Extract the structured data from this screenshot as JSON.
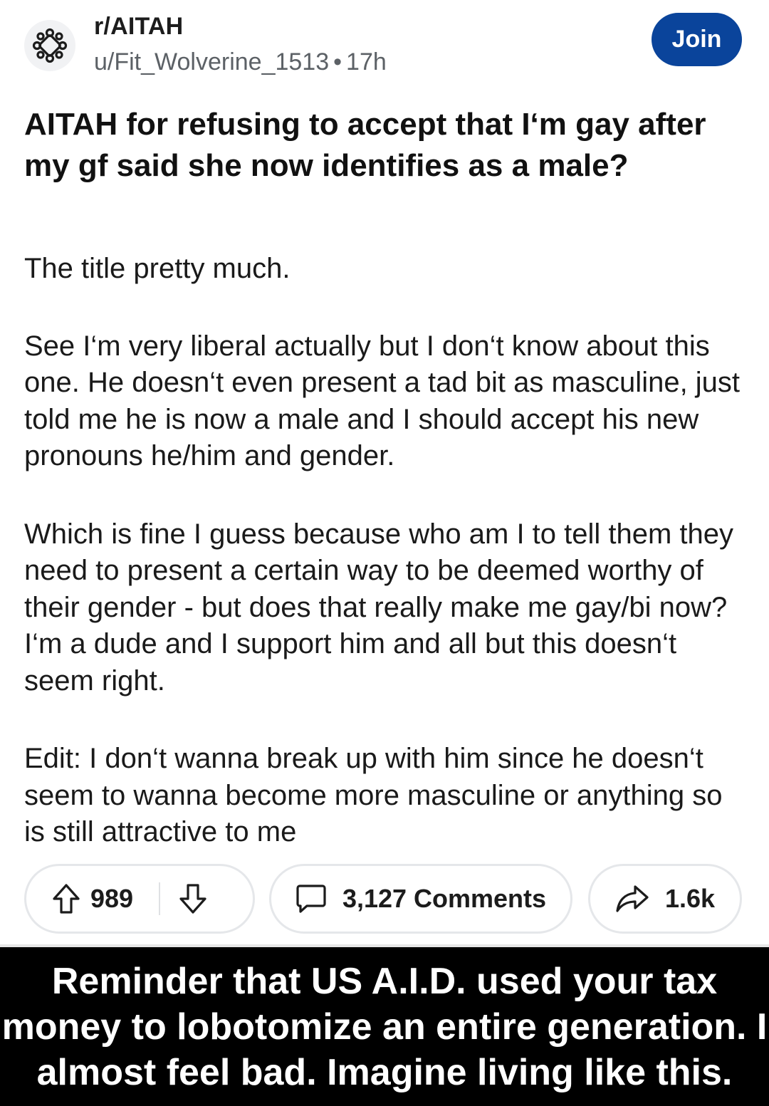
{
  "post": {
    "subreddit": "r/AITAH",
    "author": "u/Fit_Wolverine_1513",
    "separator": "•",
    "age": "17h",
    "join_label": "Join",
    "title": "AITAH for refusing to accept that I‘m gay after my gf said she now identifies as a male?",
    "body": [
      "The title pretty much.",
      "See I‘m very liberal actually but I don‘t know about this one. He doesn‘t even present a tad bit as masculine, just told me he is now a male and I should accept his new pronouns he/him and gender.",
      "Which is fine I guess because who am I to tell them they need to present a certain way to be deemed worthy of their gender - but does that really make me gay/bi now? I‘m a dude and I support him and all but this doesn‘t seem right.",
      "Edit: I don‘t wanna break up with him since he doesn‘t seem to wanna become more masculine or anything so is still attractive to me"
    ]
  },
  "actions": {
    "upvote_icon": "arrow-up-icon",
    "votes": "989",
    "downvote_icon": "arrow-down-icon",
    "comment_icon": "comment-bubble-icon",
    "comments_label": "3,127 Comments",
    "share_icon": "share-arrow-icon",
    "shares": "1.6k"
  },
  "caption": {
    "text": "Reminder that US A.I.D. used your tax money to lobotomize an entire generation. I almost feel bad. Imagine living like this."
  },
  "colors": {
    "join_button": "#0a449b",
    "meta_text": "#5c6166",
    "pill_border": "#e5e7ea",
    "caption_bg": "#000000"
  }
}
